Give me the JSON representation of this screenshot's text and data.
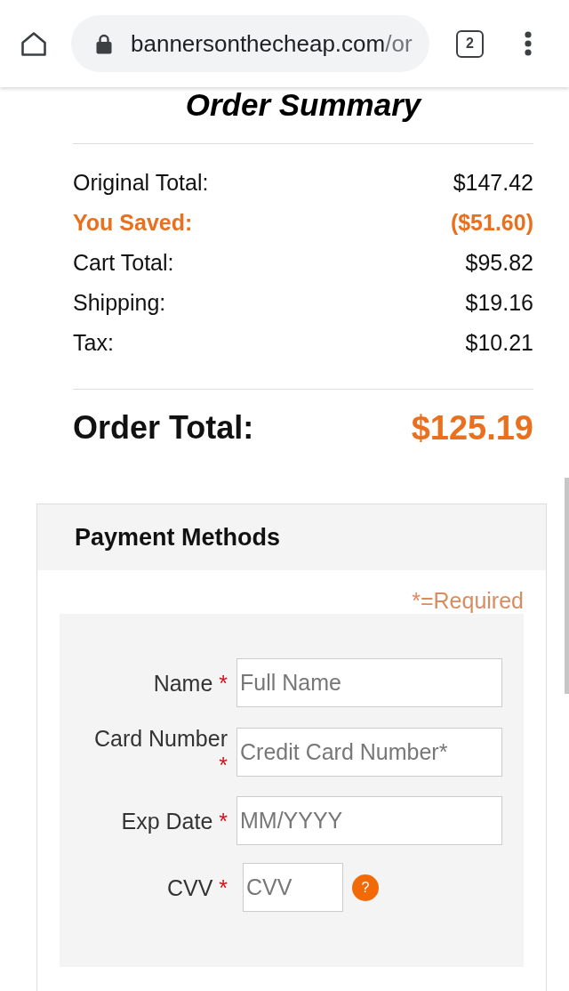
{
  "browser": {
    "url_domain": "bannersonthecheap.com",
    "url_path": "/or",
    "tab_count": "2"
  },
  "order_summary": {
    "title": "Order Summary",
    "lines": [
      {
        "kind": "plain",
        "label": "Original Total:",
        "amount": "$147.42"
      },
      {
        "kind": "discount",
        "label": "You Saved:",
        "amount": "($51.60)"
      },
      {
        "kind": "plain",
        "label": "Cart Total:",
        "amount": "$95.82"
      },
      {
        "kind": "plain",
        "label": "Shipping:",
        "amount": "$19.16"
      },
      {
        "kind": "plain",
        "label": "Tax:",
        "amount": "$10.21"
      }
    ],
    "total": {
      "label": "Order Total:",
      "amount": "$125.19"
    }
  },
  "payment": {
    "title": "Payment Methods",
    "required_note": "*=Required",
    "fields": [
      {
        "kind": "wide",
        "label": "Name",
        "required_mark": "*",
        "placeholder": "Full Name"
      },
      {
        "kind": "wide",
        "label": "Card Number",
        "required_mark": "*",
        "placeholder": "Credit Card Number*"
      },
      {
        "kind": "wide",
        "label": "Exp Date",
        "required_mark": "*",
        "placeholder": "MM/YYYY"
      },
      {
        "kind": "short",
        "label": "CVV",
        "required_mark": "*",
        "placeholder": "CVV",
        "help": "?"
      }
    ]
  }
}
